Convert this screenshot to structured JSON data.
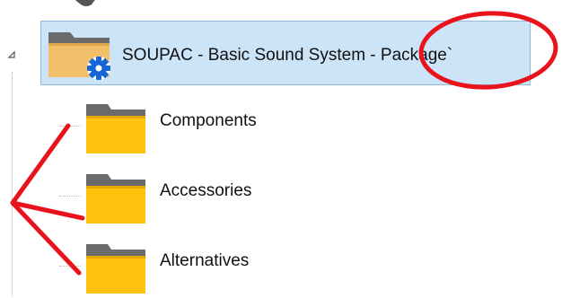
{
  "tree": {
    "root": {
      "label": "SOUPAC   - Basic Sound System  - Package`",
      "icon": "folder-gear-icon",
      "expanded": true,
      "selected": true
    },
    "children": [
      {
        "label": "Components",
        "icon": "folder-icon"
      },
      {
        "label": "Accessories",
        "icon": "folder-icon"
      },
      {
        "label": "Alternatives",
        "icon": "folder-icon"
      }
    ]
  },
  "colors": {
    "selection_background": "#cce4f7",
    "selection_border": "#8fb9e0",
    "folder_yellow": "#ffc20e",
    "folder_tab_gray": "#6b6b6b",
    "gear_blue": "#1565d8",
    "annotation_red": "#e8131b"
  }
}
